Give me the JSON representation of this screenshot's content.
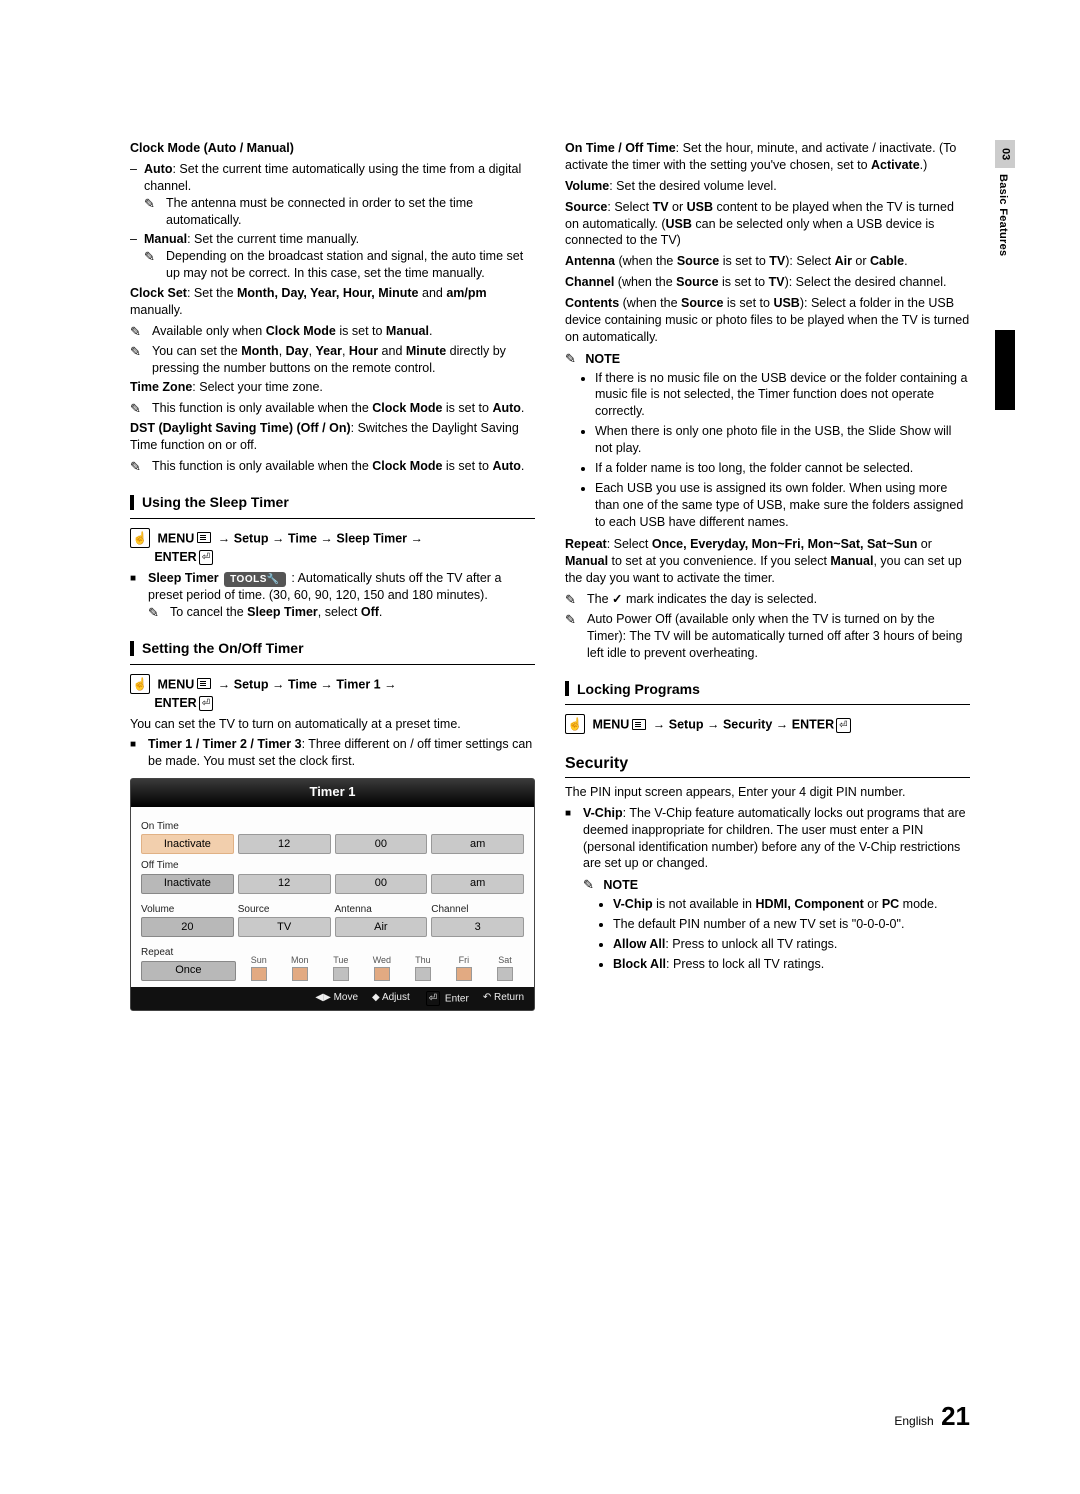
{
  "sidetab": {
    "chapter_num": "03",
    "chapter_title": "Basic Features"
  },
  "page_footer": {
    "lang": "English",
    "page_number": "21"
  },
  "left": {
    "clock_mode_heading": "Clock Mode (Auto / Manual)",
    "auto_label": "Auto",
    "auto_desc": ": Set the current time automatically using the time from a digital channel.",
    "auto_note": "The antenna must be connected in order to set the time automatically.",
    "manual_label": "Manual",
    "manual_desc": ": Set the current time manually.",
    "manual_note": "Depending on the broadcast station and signal, the auto time set up may not be correct. In this case, set the time manually.",
    "clock_set_a": "Clock Set",
    "clock_set_b": ": Set the ",
    "clock_set_c": "Month, Day, Year, Hour, Minute",
    "clock_set_d": " and ",
    "clock_set_e": "am/pm",
    "clock_set_f": " manually.",
    "clock_set_note1_a": "Available only when ",
    "clock_set_note1_b": "Clock Mode",
    "clock_set_note1_c": " is set to ",
    "clock_set_note1_d": "Manual",
    "clock_set_note1_e": ".",
    "clock_set_note2_a": "You can set the ",
    "clock_set_note2_b": "Month",
    "clock_set_note2_c": ", ",
    "clock_set_note2_d": "Day",
    "clock_set_note2_e": ", ",
    "clock_set_note2_f": "Year",
    "clock_set_note2_g": ", ",
    "clock_set_note2_h": "Hour",
    "clock_set_note2_i": " and ",
    "clock_set_note2_j": "Minute",
    "clock_set_note2_k": " directly by pressing the number buttons on the remote control.",
    "timezone_a": "Time Zone",
    "timezone_b": ": Select your time zone.",
    "timezone_note_a": "This function is only available when the ",
    "timezone_note_b": "Clock Mode",
    "timezone_note_c": " is set to ",
    "timezone_note_d": "Auto",
    "timezone_note_e": ".",
    "dst_a": "DST (Daylight Saving Time) (Off / On)",
    "dst_b": ": Switches the Daylight Saving Time function on or off.",
    "dst_note_a": "This function is only available when the ",
    "dst_note_b": "Clock Mode",
    "dst_note_c": " is set to ",
    "dst_note_d": "Auto",
    "dst_note_e": ".",
    "sleep_title": "Using the Sleep Timer",
    "sleep_path_menu": "MENU",
    "sleep_path_arrow": " → ",
    "sleep_path_setup": "Setup",
    "sleep_path_time": "Time",
    "sleep_path_sleep": "Sleep Timer",
    "sleep_path_enter": "ENTER",
    "sleep_timer_label": "Sleep Timer",
    "tools_label": "TOOLS",
    "sleep_timer_desc": ": Automatically shuts off the TV after a preset period of time. (30, 60, 90, 120, 150 and 180 minutes).",
    "sleep_cancel_a": "To cancel the ",
    "sleep_cancel_b": "Sleep Timer",
    "sleep_cancel_c": ", select ",
    "sleep_cancel_d": "Off",
    "sleep_cancel_e": ".",
    "onoff_title": "Setting the On/Off Timer",
    "onoff_path_timer1": "Timer 1",
    "onoff_intro": "You can set the TV to turn on automatically at a preset time.",
    "timer_labels_a": "Timer 1 / Timer 2 / Timer 3",
    "timer_labels_b": ": Three different on / off timer settings can be made. You must set the clock first.",
    "timer_ui": {
      "title": "Timer 1",
      "on_time_label": "On Time",
      "off_time_label": "Off Time",
      "inactivate": "Inactivate",
      "hour": "12",
      "minute": "00",
      "ampm": "am",
      "volume_label": "Volume",
      "volume": "20",
      "source_label": "Source",
      "source": "TV",
      "antenna_label": "Antenna",
      "antenna": "Air",
      "channel_label": "Channel",
      "channel": "3",
      "repeat_label": "Repeat",
      "repeat": "Once",
      "days": [
        "Sun",
        "Mon",
        "Tue",
        "Wed",
        "Thu",
        "Fri",
        "Sat"
      ],
      "footer": {
        "move": "Move",
        "adjust": "Adjust",
        "enter": "Enter",
        "return": "Return"
      }
    }
  },
  "right": {
    "ontime_a": "On Time / Off Time",
    "ontime_b": ": Set the hour, minute, and activate / inactivate. (To activate the timer with the setting you've chosen, set to ",
    "ontime_c": "Activate",
    "ontime_d": ".)",
    "volume_a": "Volume",
    "volume_b": ": Set the desired volume level.",
    "source_a": "Source",
    "source_b": ": Select ",
    "source_c": "TV",
    "source_d": " or ",
    "source_e": "USB",
    "source_f": " content to be played when the TV is turned on automatically. (",
    "source_g": "USB",
    "source_h": " can be selected only when a USB device is connected to the TV)",
    "antenna_a": "Antenna",
    "antenna_b": " (when the ",
    "antenna_c": "Source",
    "antenna_d": " is set to ",
    "antenna_e": "TV",
    "antenna_f": "): Select ",
    "antenna_g": "Air",
    "antenna_h": " or ",
    "antenna_i": "Cable",
    "antenna_j": ".",
    "channel_a": "Channel",
    "channel_b": " (when the ",
    "channel_c": "Source",
    "channel_d": " is set to ",
    "channel_e": "TV",
    "channel_f": "): Select the desired channel.",
    "contents_a": "Contents",
    "contents_b": " (when the ",
    "contents_c": "Source",
    "contents_d": " is set to ",
    "contents_e": "USB",
    "contents_f": "): Select a folder in the USB device containing music or photo files to be played when the TV is turned on automatically.",
    "note_label": "NOTE",
    "note_items": [
      "If there is no music file on the USB device or the folder containing a music file is not selected, the Timer function does not operate correctly.",
      "When there is only one photo file in the USB, the Slide Show will not play.",
      "If a folder name is too long, the folder cannot be selected.",
      "Each USB you use is assigned its own folder. When using more than one of the same type of USB, make sure the folders assigned to each USB have different names."
    ],
    "repeat_a": "Repeat",
    "repeat_b": ": Select ",
    "repeat_c": "Once, Everyday, Mon~Fri, Mon~Sat, Sat~Sun",
    "repeat_d": " or ",
    "repeat_e": "Manual",
    "repeat_f": " to set at you convenience. If you select ",
    "repeat_g": "Manual",
    "repeat_h": ", you can set up the day you want to activate the timer.",
    "repeat_check": "The ",
    "repeat_check_b": " mark indicates the day is selected.",
    "autopower": "Auto Power Off (available only when the TV is turned on by the Timer): The TV will be automatically turned off after 3 hours of being left idle to prevent overheating.",
    "locking_title": "Locking Programs",
    "locking_path_security": "Security",
    "security_title": "Security",
    "pin_line": "The PIN input screen appears, Enter your 4 digit PIN number.",
    "vchip_a": "V-Chip",
    "vchip_b": ": The V-Chip feature automatically locks out programs that are deemed inappropriate for children. The user must enter a PIN (personal identification number) before any of the V-Chip restrictions are set up or changed.",
    "vchip_notes": {
      "n1_a": "V-Chip",
      "n1_b": " is not available in ",
      "n1_c": "HDMI, Component",
      "n1_d": " or ",
      "n1_e": "PC",
      "n1_f": " mode.",
      "n2": "The default PIN number of a new TV set is \"0-0-0-0\".",
      "n3_a": "Allow All",
      "n3_b": ": Press to unlock all TV ratings.",
      "n4_a": "Block All",
      "n4_b": ": Press to lock all TV ratings."
    }
  }
}
